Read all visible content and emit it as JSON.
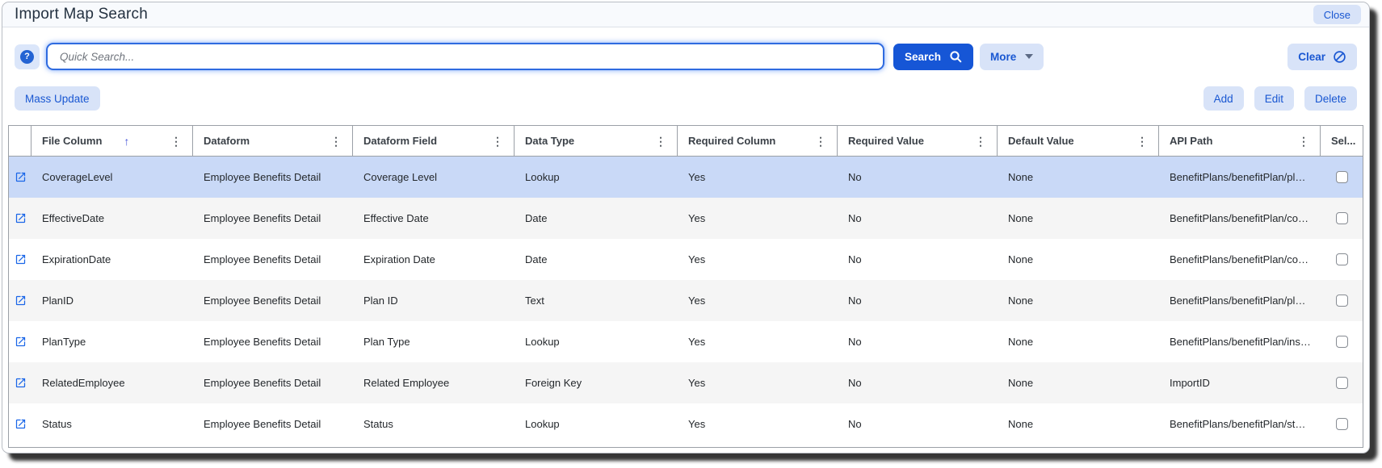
{
  "window": {
    "title": "Import Map Search",
    "close_label": "Close"
  },
  "search": {
    "placeholder": "Quick Search...",
    "value": "",
    "search_label": "Search",
    "more_label": "More",
    "clear_label": "Clear",
    "icons": {
      "help": "question-mark-circle",
      "search": "magnifier",
      "more_caret": "caret-down",
      "clear": "block-circle-slash"
    }
  },
  "actions": {
    "mass_update_label": "Mass Update",
    "add_label": "Add",
    "edit_label": "Edit",
    "delete_label": "Delete"
  },
  "table": {
    "columns": [
      {
        "key": "row_open",
        "label": "",
        "has_menu": false
      },
      {
        "key": "file_column",
        "label": "File Column",
        "sorted": "asc",
        "has_menu": true
      },
      {
        "key": "dataform",
        "label": "Dataform",
        "has_menu": true
      },
      {
        "key": "dataform_field",
        "label": "Dataform Field",
        "has_menu": true
      },
      {
        "key": "data_type",
        "label": "Data Type",
        "has_menu": true
      },
      {
        "key": "required_column",
        "label": "Required Column",
        "has_menu": true
      },
      {
        "key": "required_value",
        "label": "Required Value",
        "has_menu": true
      },
      {
        "key": "default_value",
        "label": "Default Value",
        "has_menu": true
      },
      {
        "key": "api_path",
        "label": "API Path",
        "has_menu": true
      },
      {
        "key": "select",
        "label": "Sel...",
        "has_menu": false
      }
    ],
    "selected_row_index": 0,
    "rows": [
      {
        "file_column": "CoverageLevel",
        "dataform": "Employee Benefits Detail",
        "dataform_field": "Coverage Level",
        "data_type": "Lookup",
        "required_column": "Yes",
        "required_value": "No",
        "default_value": "None",
        "api_path": "BenefitPlans/benefitPlan/planDetail/...",
        "selected": false
      },
      {
        "file_column": "EffectiveDate",
        "dataform": "Employee Benefits Detail",
        "dataform_field": "Effective Date",
        "data_type": "Date",
        "required_column": "Yes",
        "required_value": "No",
        "default_value": "None",
        "api_path": "BenefitPlans/benefitPlan/coverageS...",
        "selected": false
      },
      {
        "file_column": "ExpirationDate",
        "dataform": "Employee Benefits Detail",
        "dataform_field": "Expiration Date",
        "data_type": "Date",
        "required_column": "Yes",
        "required_value": "No",
        "default_value": "None",
        "api_path": "BenefitPlans/benefitPlan/coverageE...",
        "selected": false
      },
      {
        "file_column": "PlanID",
        "dataform": "Employee Benefits Detail",
        "dataform_field": "Plan ID",
        "data_type": "Text",
        "required_column": "Yes",
        "required_value": "No",
        "default_value": "None",
        "api_path": "BenefitPlans/benefitPlan/planId",
        "selected": false
      },
      {
        "file_column": "PlanType",
        "dataform": "Employee Benefits Detail",
        "dataform_field": "Plan Type",
        "data_type": "Lookup",
        "required_column": "Yes",
        "required_value": "No",
        "default_value": "None",
        "api_path": "BenefitPlans/benefitPlan/insClass",
        "selected": false
      },
      {
        "file_column": "RelatedEmployee",
        "dataform": "Employee Benefits Detail",
        "dataform_field": "Related Employee",
        "data_type": "Foreign Key",
        "required_column": "Yes",
        "required_value": "No",
        "default_value": "None",
        "api_path": "ImportID",
        "selected": false
      },
      {
        "file_column": "Status",
        "dataform": "Employee Benefits Detail",
        "dataform_field": "Status",
        "data_type": "Lookup",
        "required_column": "Yes",
        "required_value": "No",
        "default_value": "None",
        "api_path": "BenefitPlans/benefitPlan/status",
        "selected": false
      }
    ],
    "icons": {
      "row_open": "open-in-new",
      "column_menu": "kebab-vertical",
      "sort": "arrow-up",
      "row_select": "checkbox-unchecked"
    }
  },
  "colors": {
    "accent_blue": "#1656d6",
    "light_button_bg": "#d8e3f8",
    "button_text_blue": "#1957d2",
    "selected_row_bg": "#c9d9f7",
    "alt_row_bg": "#f5f5f5",
    "table_border": "#9ba0a7"
  }
}
